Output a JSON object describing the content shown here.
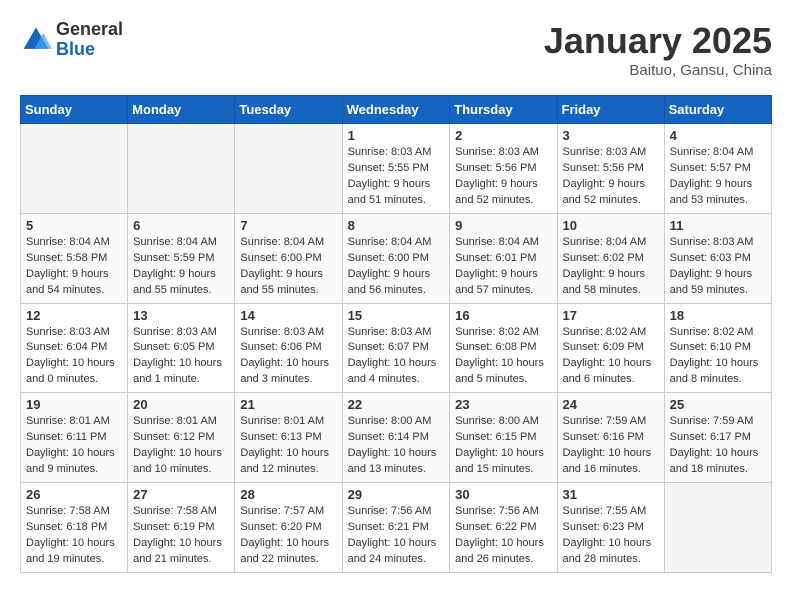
{
  "header": {
    "logo_general": "General",
    "logo_blue": "Blue",
    "month_title": "January 2025",
    "location": "Baituo, Gansu, China"
  },
  "weekdays": [
    "Sunday",
    "Monday",
    "Tuesday",
    "Wednesday",
    "Thursday",
    "Friday",
    "Saturday"
  ],
  "weeks": [
    [
      {
        "day": "",
        "info": ""
      },
      {
        "day": "",
        "info": ""
      },
      {
        "day": "",
        "info": ""
      },
      {
        "day": "1",
        "info": "Sunrise: 8:03 AM\nSunset: 5:55 PM\nDaylight: 9 hours\nand 51 minutes."
      },
      {
        "day": "2",
        "info": "Sunrise: 8:03 AM\nSunset: 5:56 PM\nDaylight: 9 hours\nand 52 minutes."
      },
      {
        "day": "3",
        "info": "Sunrise: 8:03 AM\nSunset: 5:56 PM\nDaylight: 9 hours\nand 52 minutes."
      },
      {
        "day": "4",
        "info": "Sunrise: 8:04 AM\nSunset: 5:57 PM\nDaylight: 9 hours\nand 53 minutes."
      }
    ],
    [
      {
        "day": "5",
        "info": "Sunrise: 8:04 AM\nSunset: 5:58 PM\nDaylight: 9 hours\nand 54 minutes."
      },
      {
        "day": "6",
        "info": "Sunrise: 8:04 AM\nSunset: 5:59 PM\nDaylight: 9 hours\nand 55 minutes."
      },
      {
        "day": "7",
        "info": "Sunrise: 8:04 AM\nSunset: 6:00 PM\nDaylight: 9 hours\nand 55 minutes."
      },
      {
        "day": "8",
        "info": "Sunrise: 8:04 AM\nSunset: 6:00 PM\nDaylight: 9 hours\nand 56 minutes."
      },
      {
        "day": "9",
        "info": "Sunrise: 8:04 AM\nSunset: 6:01 PM\nDaylight: 9 hours\nand 57 minutes."
      },
      {
        "day": "10",
        "info": "Sunrise: 8:04 AM\nSunset: 6:02 PM\nDaylight: 9 hours\nand 58 minutes."
      },
      {
        "day": "11",
        "info": "Sunrise: 8:03 AM\nSunset: 6:03 PM\nDaylight: 9 hours\nand 59 minutes."
      }
    ],
    [
      {
        "day": "12",
        "info": "Sunrise: 8:03 AM\nSunset: 6:04 PM\nDaylight: 10 hours\nand 0 minutes."
      },
      {
        "day": "13",
        "info": "Sunrise: 8:03 AM\nSunset: 6:05 PM\nDaylight: 10 hours\nand 1 minute."
      },
      {
        "day": "14",
        "info": "Sunrise: 8:03 AM\nSunset: 6:06 PM\nDaylight: 10 hours\nand 3 minutes."
      },
      {
        "day": "15",
        "info": "Sunrise: 8:03 AM\nSunset: 6:07 PM\nDaylight: 10 hours\nand 4 minutes."
      },
      {
        "day": "16",
        "info": "Sunrise: 8:02 AM\nSunset: 6:08 PM\nDaylight: 10 hours\nand 5 minutes."
      },
      {
        "day": "17",
        "info": "Sunrise: 8:02 AM\nSunset: 6:09 PM\nDaylight: 10 hours\nand 6 minutes."
      },
      {
        "day": "18",
        "info": "Sunrise: 8:02 AM\nSunset: 6:10 PM\nDaylight: 10 hours\nand 8 minutes."
      }
    ],
    [
      {
        "day": "19",
        "info": "Sunrise: 8:01 AM\nSunset: 6:11 PM\nDaylight: 10 hours\nand 9 minutes."
      },
      {
        "day": "20",
        "info": "Sunrise: 8:01 AM\nSunset: 6:12 PM\nDaylight: 10 hours\nand 10 minutes."
      },
      {
        "day": "21",
        "info": "Sunrise: 8:01 AM\nSunset: 6:13 PM\nDaylight: 10 hours\nand 12 minutes."
      },
      {
        "day": "22",
        "info": "Sunrise: 8:00 AM\nSunset: 6:14 PM\nDaylight: 10 hours\nand 13 minutes."
      },
      {
        "day": "23",
        "info": "Sunrise: 8:00 AM\nSunset: 6:15 PM\nDaylight: 10 hours\nand 15 minutes."
      },
      {
        "day": "24",
        "info": "Sunrise: 7:59 AM\nSunset: 6:16 PM\nDaylight: 10 hours\nand 16 minutes."
      },
      {
        "day": "25",
        "info": "Sunrise: 7:59 AM\nSunset: 6:17 PM\nDaylight: 10 hours\nand 18 minutes."
      }
    ],
    [
      {
        "day": "26",
        "info": "Sunrise: 7:58 AM\nSunset: 6:18 PM\nDaylight: 10 hours\nand 19 minutes."
      },
      {
        "day": "27",
        "info": "Sunrise: 7:58 AM\nSunset: 6:19 PM\nDaylight: 10 hours\nand 21 minutes."
      },
      {
        "day": "28",
        "info": "Sunrise: 7:57 AM\nSunset: 6:20 PM\nDaylight: 10 hours\nand 22 minutes."
      },
      {
        "day": "29",
        "info": "Sunrise: 7:56 AM\nSunset: 6:21 PM\nDaylight: 10 hours\nand 24 minutes."
      },
      {
        "day": "30",
        "info": "Sunrise: 7:56 AM\nSunset: 6:22 PM\nDaylight: 10 hours\nand 26 minutes."
      },
      {
        "day": "31",
        "info": "Sunrise: 7:55 AM\nSunset: 6:23 PM\nDaylight: 10 hours\nand 28 minutes."
      },
      {
        "day": "",
        "info": ""
      }
    ]
  ]
}
